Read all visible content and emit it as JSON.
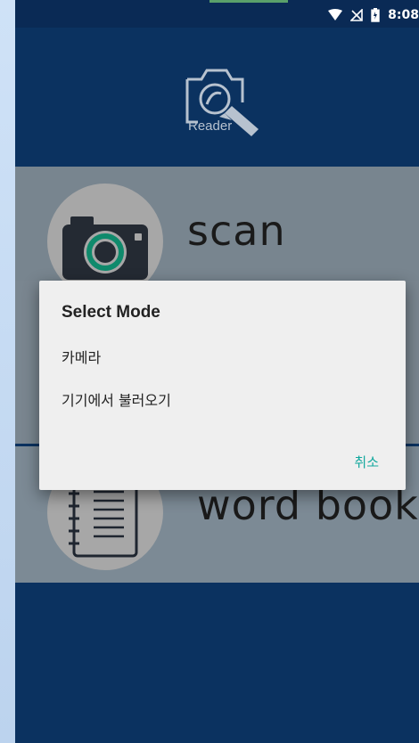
{
  "status_bar": {
    "time": "8:08",
    "icons": [
      "wifi-icon",
      "no-signal-icon",
      "battery-icon"
    ]
  },
  "app": {
    "logo_text": "Reader",
    "menu": [
      {
        "label": "scan",
        "icon": "camera-icon"
      },
      {
        "label": "word book",
        "icon": "notebook-icon"
      }
    ]
  },
  "dialog": {
    "title": "Select Mode",
    "options": [
      "카메라",
      "기기에서 불러오기"
    ],
    "cancel_label": "취소",
    "accent_color": "#13a89e"
  }
}
